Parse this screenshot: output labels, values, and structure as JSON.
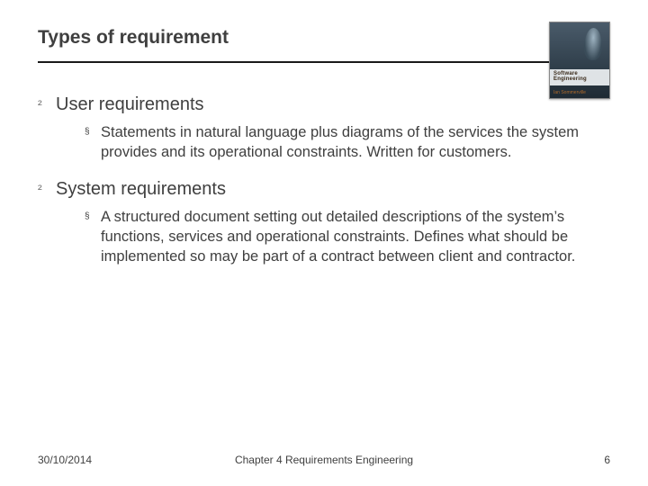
{
  "title": "Types of requirement",
  "cover": {
    "line1": "Software Engineering",
    "line2": "Ian Sommerville"
  },
  "items": [
    {
      "heading": "User requirements",
      "sub": "Statements in natural language plus diagrams of the services the system provides and its operational constraints. Written for customers."
    },
    {
      "heading": "System requirements",
      "sub": "A structured document setting out detailed descriptions of the system’s functions, services and operational constraints. Defines what should be implemented so may be part of a contract between client and contractor."
    }
  ],
  "footer": {
    "date": "30/10/2014",
    "center": "Chapter 4 Requirements Engineering",
    "page": "6"
  },
  "bullets": {
    "l1": "²",
    "l2": "§"
  }
}
